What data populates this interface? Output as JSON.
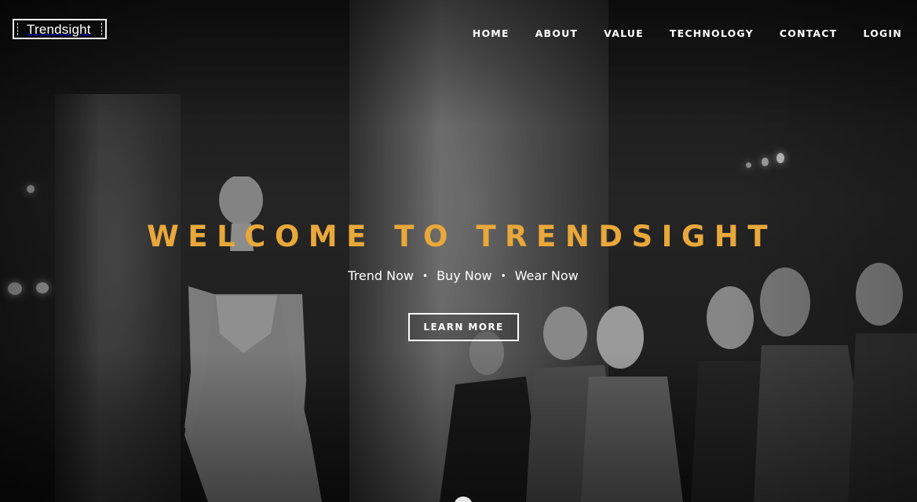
{
  "brand": {
    "logo_text": "Trendsight"
  },
  "nav": {
    "items": [
      {
        "label": "HOME"
      },
      {
        "label": "ABOUT"
      },
      {
        "label": "VALUE"
      },
      {
        "label": "TECHNOLOGY"
      },
      {
        "label": "CONTACT"
      },
      {
        "label": "LOGIN"
      }
    ]
  },
  "hero": {
    "headline": "WELCOME TO TRENDSIGHT",
    "tagline": {
      "parts": [
        "Trend Now",
        "Buy Now",
        "Wear Now"
      ],
      "separator": "•"
    },
    "cta_label": "LEARN MORE",
    "background": "fashion-runway-photo"
  },
  "colors": {
    "accent": "#e9a83a",
    "text": "#ffffff"
  }
}
